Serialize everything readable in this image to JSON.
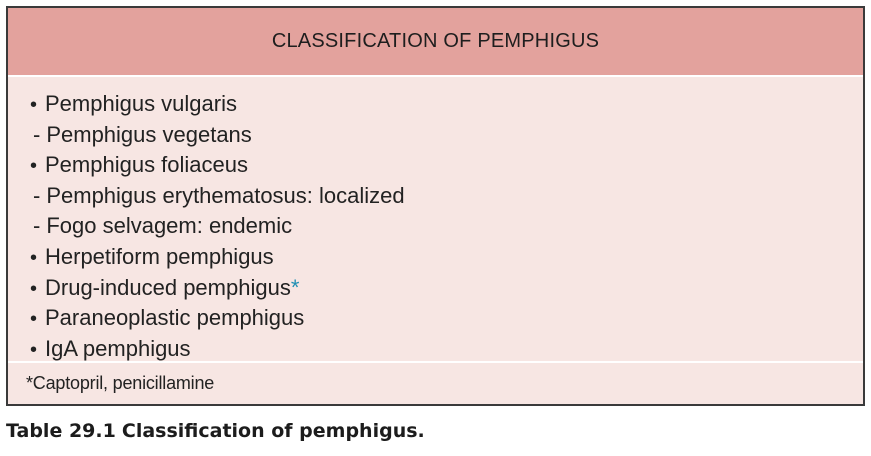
{
  "table": {
    "header": "CLASSIFICATION OF PEMPHIGUS",
    "items": [
      {
        "type": "main",
        "bullet": "•",
        "text": "Pemphigus vulgaris"
      },
      {
        "type": "sub",
        "dash": "-",
        "text": "Pemphigus vegetans"
      },
      {
        "type": "main",
        "bullet": "•",
        "text": "Pemphigus foliaceus"
      },
      {
        "type": "sub",
        "dash": "-",
        "text": "Pemphigus erythematosus: localized"
      },
      {
        "type": "sub",
        "dash": "-",
        "text": "Fogo selvagem: endemic"
      },
      {
        "type": "main",
        "bullet": "•",
        "text": "Herpetiform pemphigus"
      },
      {
        "type": "main",
        "bullet": "•",
        "text": "Drug-induced pemphigus",
        "marker": "*"
      },
      {
        "type": "main",
        "bullet": "•",
        "text": "Paraneoplastic pemphigus"
      },
      {
        "type": "main",
        "bullet": "•",
        "text": "IgA pemphigus"
      }
    ],
    "footnote": "*Captopril, penicillamine"
  },
  "caption": {
    "label": "Table 29.1",
    "text": "Classification of pemphigus."
  },
  "colors": {
    "header_bg": "#e3a29d",
    "body_bg": "#f7e6e3",
    "border": "#3a3a3a",
    "asterisk": "#1f8fb3"
  }
}
